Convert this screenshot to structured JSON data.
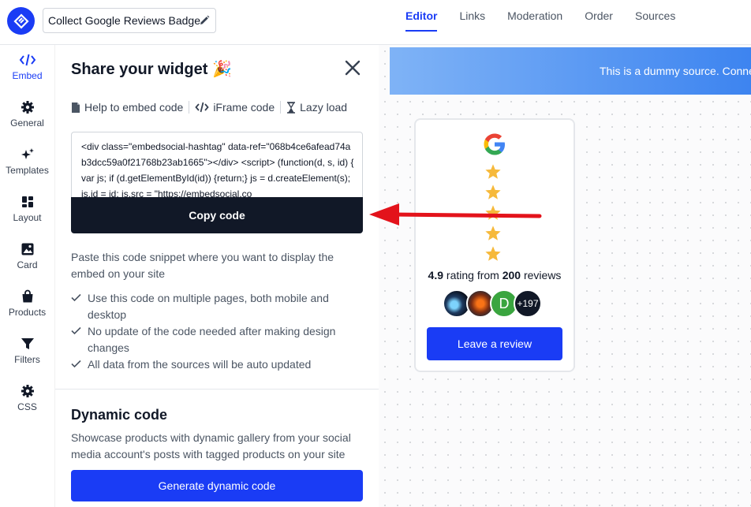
{
  "header": {
    "widget_title": "Collect Google Reviews Badge",
    "tabs": [
      {
        "label": "Editor",
        "active": true
      },
      {
        "label": "Links",
        "active": false
      },
      {
        "label": "Moderation",
        "active": false
      },
      {
        "label": "Order",
        "active": false
      },
      {
        "label": "Sources",
        "active": false
      }
    ]
  },
  "sidebar": {
    "items": [
      {
        "label": "Embed",
        "icon": "code-icon",
        "active": true
      },
      {
        "label": "General",
        "icon": "gear-icon"
      },
      {
        "label": "Templates",
        "icon": "sparkles-icon"
      },
      {
        "label": "Layout",
        "icon": "layout-grid-icon"
      },
      {
        "label": "Card",
        "icon": "image-icon"
      },
      {
        "label": "Products",
        "icon": "shopping-bag-icon"
      },
      {
        "label": "Filters",
        "icon": "filter-icon"
      },
      {
        "label": "CSS",
        "icon": "gear-icon"
      }
    ]
  },
  "share": {
    "title": "Share your widget",
    "title_emoji": "🎉",
    "links": {
      "help": "Help to embed code",
      "iframe": "iFrame code",
      "lazy": "Lazy load"
    },
    "code": "<div class=\"embedsocial-hashtag\" data-ref=\"068b4ce6afead74ab3dcc59a0f21768b23ab1665\"></div> <script> (function(d, s, id) { var js; if (d.getElementById(id)) {return;} js = d.createElement(s); js.id = id; js.src = \"https://embedsocial.co",
    "copy_button": "Copy code",
    "paste_text": "Paste this code snippet where you want to display the embed on your site",
    "checks": [
      "Use this code on multiple pages, both mobile and desktop",
      "No update of the code needed after making design changes",
      "All data from the sources will be auto updated"
    ],
    "dynamic_title": "Dynamic code",
    "dynamic_text": "Showcase products with dynamic gallery from your social media account's posts with tagged products on your site",
    "dynamic_button": "Generate dynamic code"
  },
  "preview": {
    "banner_text": "This is a dummy source. Conne",
    "badge": {
      "rating": "4.9",
      "rating_mid": " rating from ",
      "review_count": "200",
      "rating_suffix": " reviews",
      "stars": 5,
      "avatar_letter": "D",
      "more_count": "+197",
      "button_label": "Leave a review"
    }
  },
  "colors": {
    "accent": "#1a3cf5",
    "dark_button": "#111827",
    "star": "#f6b93b",
    "annotation_arrow": "#e3131b"
  }
}
